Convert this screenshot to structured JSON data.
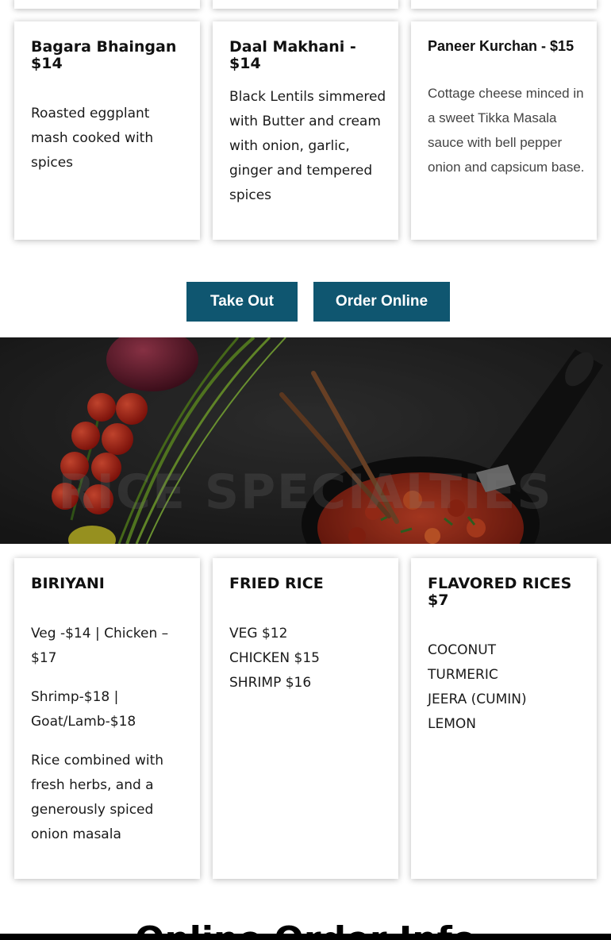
{
  "top_cards": [
    {
      "title": "Bagara Bhaingan $14",
      "body": [
        "Roasted eggplant mash cooked with spices"
      ]
    },
    {
      "title": "Daal Makhani - $14",
      "body": [
        "Black Lentils simmered with Butter and cream with onion, garlic, ginger and tempered spices"
      ]
    },
    {
      "title": "Paneer Kurchan - $15",
      "body": [
        " Cottage cheese minced in a sweet Tikka Masala sauce with bell pepper onion and capsicum base."
      ]
    }
  ],
  "buttons": {
    "take_out": "Take Out",
    "order_online": "Order Online"
  },
  "hero": {
    "title": "RICE SPECIALTIES"
  },
  "rice_cards": [
    {
      "title": "BIRIYANI",
      "paragraphs": [
        "Veg -$14 | Chicken – $17",
        "Shrimp-$18 | Goat/Lamb-$18",
        "Rice combined with fresh herbs, and a generously spiced onion masala"
      ]
    },
    {
      "title": "FRIED RICE",
      "lines": [
        "VEG $12",
        "CHICKEN $15",
        "SHRIMP $16"
      ]
    },
    {
      "title": "FLAVORED RICES $7",
      "lines": [
        "COCONUT",
        "TURMERIC",
        "JEERA (CUMIN)",
        "LEMON"
      ]
    }
  ],
  "footer": {
    "title": "Online Order Info"
  },
  "colors": {
    "button_bg": "#0f5670",
    "button_text": "#ffffff",
    "hero_bg": "#2a2a2a"
  }
}
